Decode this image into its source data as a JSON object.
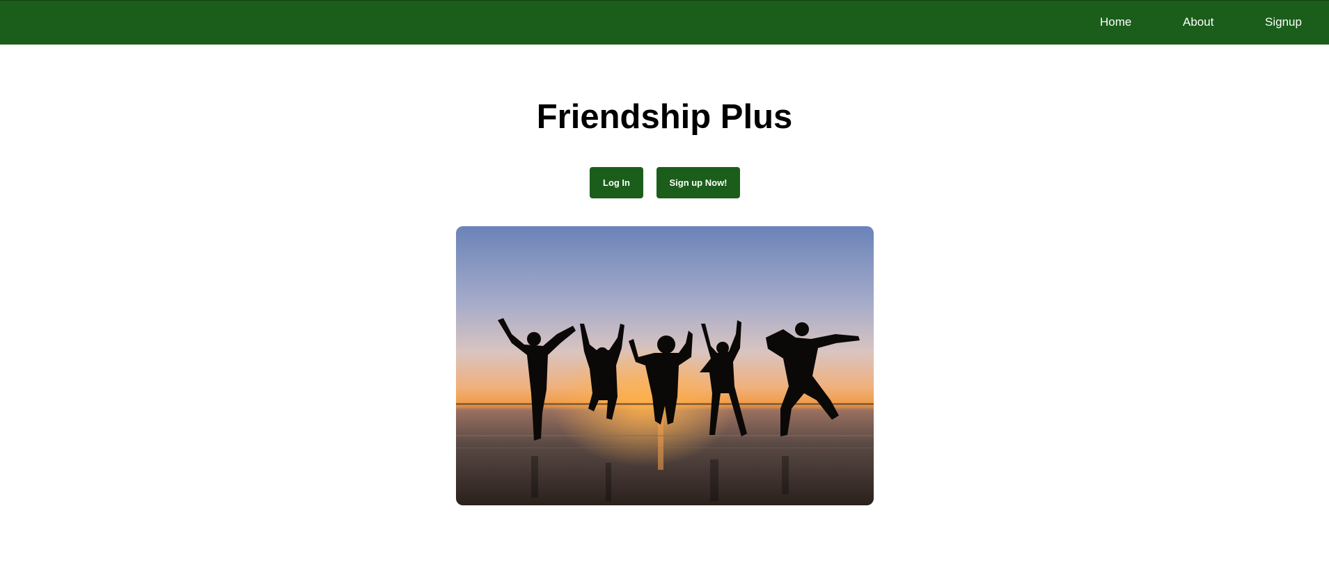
{
  "nav": {
    "items": [
      {
        "label": "Home"
      },
      {
        "label": "About"
      },
      {
        "label": "Signup"
      }
    ]
  },
  "main": {
    "title": "Friendship Plus",
    "login_label": "Log In",
    "signup_label": "Sign up Now!"
  },
  "hero_image": {
    "subject": "silhouettes of five friends jumping on a beach at sunset",
    "colors": {
      "sky_top": "#6a83b8",
      "sky_mid": "#d9c4c0",
      "horizon": "#f09a42",
      "sea": "#5a4a45"
    }
  },
  "colors": {
    "brand": "#1b5e1b",
    "nav_text": "#ffffff",
    "title_text": "#000000"
  }
}
